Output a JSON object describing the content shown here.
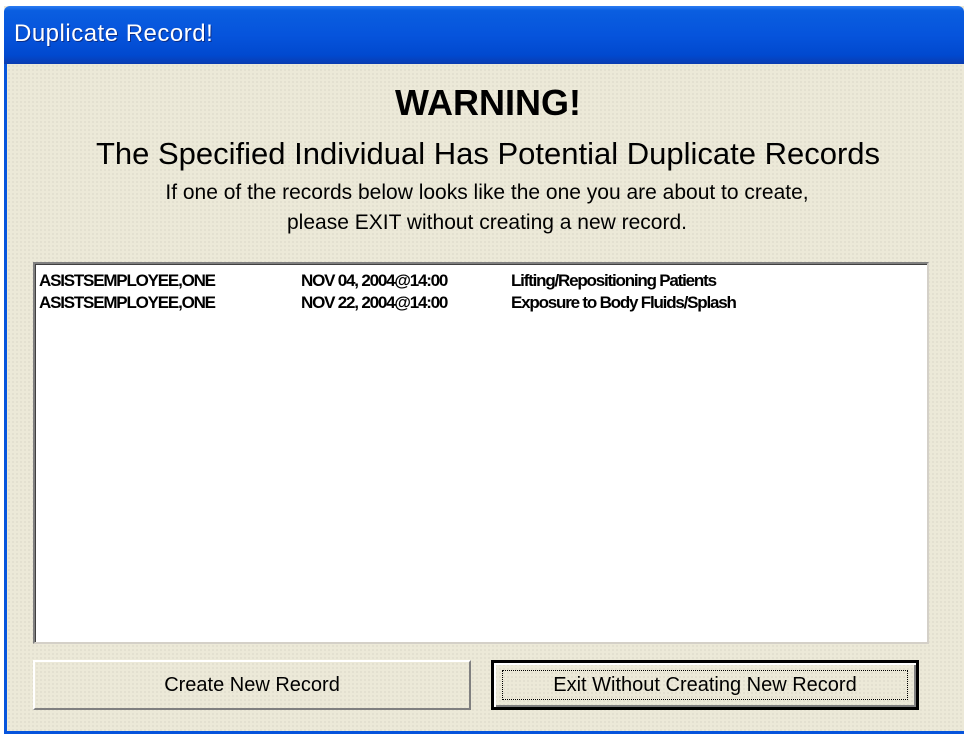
{
  "window": {
    "title": "Duplicate Record!"
  },
  "warning": {
    "title": "WARNING!",
    "subtitle": "The Specified Individual Has Potential Duplicate Records",
    "instruction_line1": "If one of the records below looks like the one you are about to create,",
    "instruction_line2": "please EXIT without creating a new record."
  },
  "records": [
    {
      "name": "ASISTSEMPLOYEE,ONE",
      "date": "NOV 04, 2004@14:00",
      "description": "Lifting/Repositioning Patients"
    },
    {
      "name": "ASISTSEMPLOYEE,ONE",
      "date": "NOV 22, 2004@14:00",
      "description": "Exposure to Body Fluids/Splash"
    }
  ],
  "buttons": {
    "create_label": "Create New Record",
    "exit_label": "Exit Without Creating New Record"
  }
}
